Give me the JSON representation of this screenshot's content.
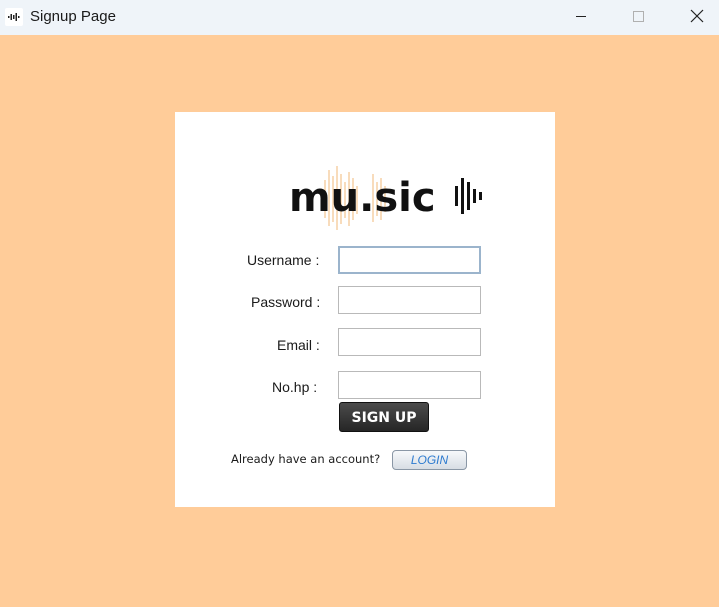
{
  "window": {
    "title": "Signup Page"
  },
  "logo": {
    "text": "mu.sic"
  },
  "form": {
    "username_label": "Username :",
    "password_label": "Password :",
    "email_label": "Email :",
    "phone_label": "No.hp :",
    "username_value": "",
    "password_value": "",
    "email_value": "",
    "phone_value": "",
    "signup_label": "SIGN UP"
  },
  "footer": {
    "prompt": "Already have an account?",
    "login_label": "LOGIN"
  },
  "colors": {
    "background": "#ffcc99",
    "card": "#ffffff",
    "accent": "#2e7bcf",
    "logo_wave": "#f2c58f"
  }
}
